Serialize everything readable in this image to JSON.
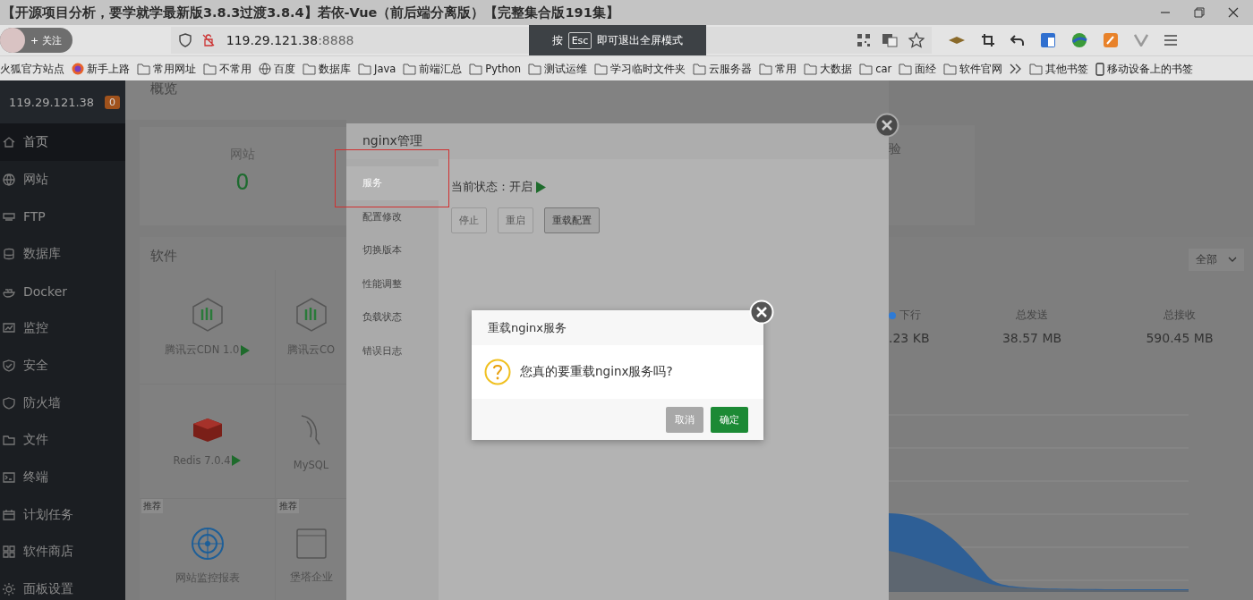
{
  "video_title": "【开源项目分析，要学就学最新版3.8.3过渡3.8.4】若依-Vue（前后端分离版）【完整集合版191集】",
  "browser": {
    "follow_label": "+ 关注",
    "address": "119.29.121.38",
    "port": ":8888",
    "fullscreen_hint": {
      "prefix": "按",
      "key": "Esc",
      "text": "即可退出全屏模式"
    },
    "bookmarks": [
      {
        "label": "火狐官方站点",
        "kind": "plain"
      },
      {
        "label": "新手上路",
        "kind": "firefox"
      },
      {
        "label": "常用网址",
        "kind": "folder"
      },
      {
        "label": "不常用",
        "kind": "folder"
      },
      {
        "label": "百度",
        "kind": "globe"
      },
      {
        "label": "数据库",
        "kind": "folder"
      },
      {
        "label": "Java",
        "kind": "folder"
      },
      {
        "label": "前端汇总",
        "kind": "folder"
      },
      {
        "label": "Python",
        "kind": "folder"
      },
      {
        "label": "测试运维",
        "kind": "folder"
      },
      {
        "label": "学习临时文件夹",
        "kind": "folder"
      },
      {
        "label": "云服务器",
        "kind": "folder"
      },
      {
        "label": "常用",
        "kind": "folder"
      },
      {
        "label": "大数据",
        "kind": "folder"
      },
      {
        "label": "car",
        "kind": "folder"
      },
      {
        "label": "面经",
        "kind": "folder"
      },
      {
        "label": "软件官网",
        "kind": "folder"
      }
    ],
    "bookmarks_right": [
      {
        "label": "其他书签",
        "kind": "folder"
      },
      {
        "label": "移动设备上的书签",
        "kind": "mobile"
      }
    ]
  },
  "sidebar": {
    "host": "119.29.121.38",
    "badge": "0",
    "items": [
      {
        "label": "首页",
        "selected": true
      },
      {
        "label": "网站",
        "selected": false
      },
      {
        "label": "FTP",
        "selected": false
      },
      {
        "label": "数据库",
        "selected": false
      },
      {
        "label": "Docker",
        "selected": false
      },
      {
        "label": "监控",
        "selected": false
      },
      {
        "label": "安全",
        "selected": false
      },
      {
        "label": "防火墙",
        "selected": false
      },
      {
        "label": "文件",
        "selected": false
      },
      {
        "label": "终端",
        "selected": false
      },
      {
        "label": "计划任务",
        "selected": false
      },
      {
        "label": "软件商店",
        "selected": false
      },
      {
        "label": "面板设置",
        "selected": false
      }
    ]
  },
  "overview": {
    "title": "概览",
    "cards": [
      {
        "label": "网站",
        "value": "0"
      }
    ],
    "cut_label": "验"
  },
  "software": {
    "title": "软件",
    "items": [
      {
        "name": "腾讯云CDN 1.0",
        "kind": "cdn",
        "playable": true
      },
      {
        "name": "腾讯云CO",
        "kind": "cos"
      },
      {
        "name": "Redis 7.0.4",
        "kind": "redis",
        "playable": true
      },
      {
        "name": "MySQL",
        "kind": "mysql"
      },
      {
        "name": "网站监控报表",
        "kind": "radar",
        "tag": "推荐"
      },
      {
        "name": "堡塔企业",
        "kind": "window",
        "tag": "推荐"
      }
    ]
  },
  "traffic": {
    "filter": "全部",
    "stats": [
      {
        "label": "下行",
        "value": ".23 KB",
        "color": "#2f7bd6"
      },
      {
        "label": "总发送",
        "value": "38.57 MB"
      },
      {
        "label": "总接收",
        "value": "590.45 MB"
      }
    ]
  },
  "nginx_modal": {
    "title": "nginx管理",
    "menu": [
      {
        "label": "服务",
        "selected": true
      },
      {
        "label": "配置修改",
        "selected": false
      },
      {
        "label": "切换版本",
        "selected": false
      },
      {
        "label": "性能调整",
        "selected": false
      },
      {
        "label": "负载状态",
        "selected": false
      },
      {
        "label": "错误日志",
        "selected": false
      }
    ],
    "status_label": "当前状态：",
    "status_value": "开启",
    "running": true,
    "buttons": [
      {
        "label": "停止",
        "active": false
      },
      {
        "label": "重启",
        "active": false
      },
      {
        "label": "重载配置",
        "active": true
      }
    ]
  },
  "confirm": {
    "title": "重载nginx服务",
    "message": "您真的要重载nginx服务吗?",
    "buttons": [
      {
        "label": "取消",
        "kind": "cancel"
      },
      {
        "label": "确定",
        "kind": "primary"
      }
    ]
  }
}
